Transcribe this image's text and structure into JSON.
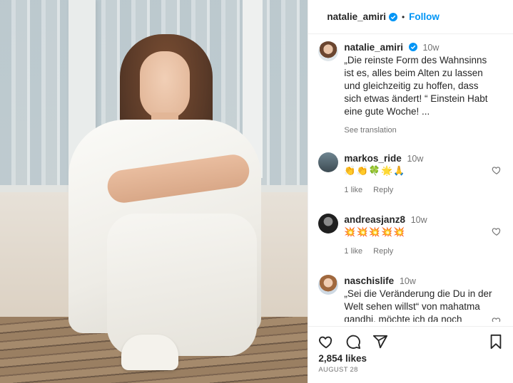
{
  "header": {
    "username": "natalie_amiri",
    "separator": "•",
    "follow_label": "Follow"
  },
  "caption": {
    "username": "natalie_amiri",
    "time": "10w",
    "text": "„Die reinste Form des Wahnsinns ist es, alles beim Alten zu lassen und gleichzeitig zu hoffen, dass sich etwas ändert! “ Einstein Habt eine gute Woche! ...",
    "see_translation": "See translation"
  },
  "comments": [
    {
      "username": "markos_ride",
      "time": "10w",
      "text": "👏👏🍀🌟🙏",
      "likes": "1 like",
      "reply": "Reply"
    },
    {
      "username": "andreasjanz8",
      "time": "10w",
      "text": "💥💥💥💥💥",
      "likes": "1 like",
      "reply": "Reply"
    },
    {
      "username": "naschislife",
      "time": "10w",
      "text": "„Sei die Veränderung die Du in der Welt sehen willst“ von mahatma gandhi, möchte ich da noch anführen. Denn das ist der Fehler, den die meisten Menschen begehen. Sie wollen Veränderung"
    }
  ],
  "post": {
    "likes": "2,854 likes",
    "date": "AUGUST 28"
  },
  "icons": {
    "verified": "verified-badge-icon",
    "like": "heart-icon",
    "comment": "comment-icon",
    "share": "share-icon",
    "save": "bookmark-icon"
  },
  "colors": {
    "accent": "#0095f6",
    "muted": "#737373",
    "text": "#262626"
  }
}
